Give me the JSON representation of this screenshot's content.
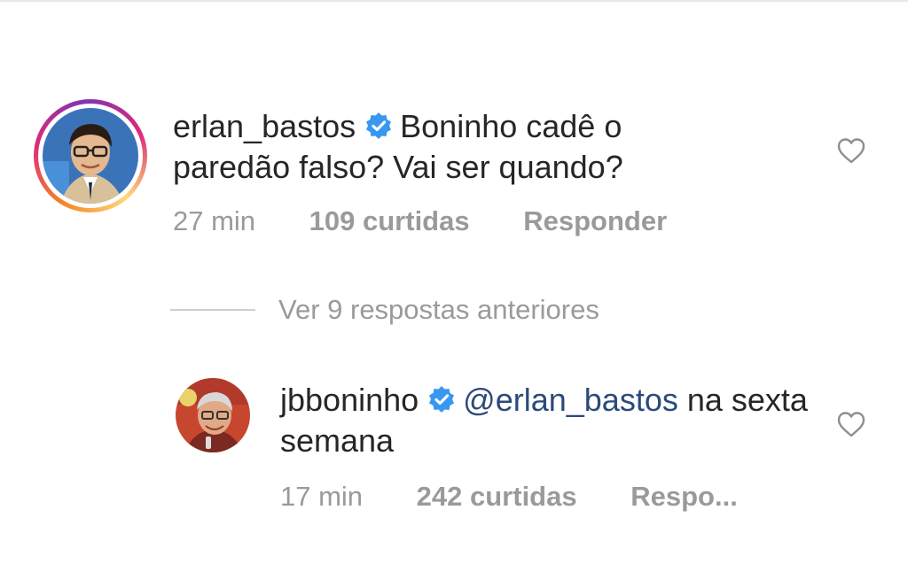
{
  "comments": [
    {
      "username": "erlan_bastos",
      "verified": true,
      "text": "Boninho cadê o paredão falso? Vai ser quando?",
      "time": "27 min",
      "likes": "109 curtidas",
      "reply_label": "Responder"
    },
    {
      "username": "jbboninho",
      "verified": true,
      "mention": "@erlan_bastos",
      "text": "na sexta semana",
      "time": "17 min",
      "likes": "242 curtidas",
      "reply_label": "Respo..."
    }
  ],
  "view_replies": {
    "label": "Ver 9 respostas anteriores"
  },
  "colors": {
    "verified_badge": "#3897f0",
    "meta_text": "#9a9a9a",
    "mention": "#2b4a7a"
  },
  "icons": {
    "like": "heart-outline-icon",
    "verified": "verified-badge-icon"
  }
}
